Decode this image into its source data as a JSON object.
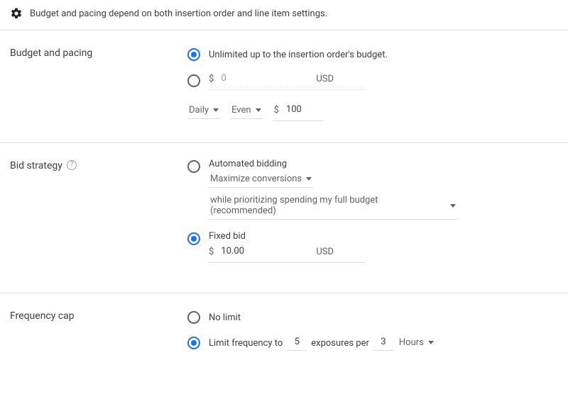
{
  "hint": "Budget and pacing depend on both insertion order and line item settings.",
  "budget": {
    "label": "Budget and pacing",
    "unlimited_label": "Unlimited up to the insertion order's budget.",
    "fixed_prefix": "$",
    "fixed_placeholder": "0",
    "fixed_currency": "USD",
    "pacing_interval": "Daily",
    "pacing_mode": "Even",
    "pacing_prefix": "$",
    "pacing_value": "100"
  },
  "bid": {
    "label": "Bid strategy",
    "auto_label": "Automated bidding",
    "auto_goal": "Maximize conversions",
    "auto_priority": "while prioritizing spending my full budget (recommended)",
    "fixed_label": "Fixed bid",
    "fixed_prefix": "$",
    "fixed_value": "10.00",
    "fixed_currency": "USD"
  },
  "freq": {
    "label": "Frequency cap",
    "nolimit_label": "No limit",
    "limit_prefix": "Limit frequency to",
    "exposures": "5",
    "limit_mid": "exposures per",
    "count": "3",
    "unit": "Hours"
  }
}
